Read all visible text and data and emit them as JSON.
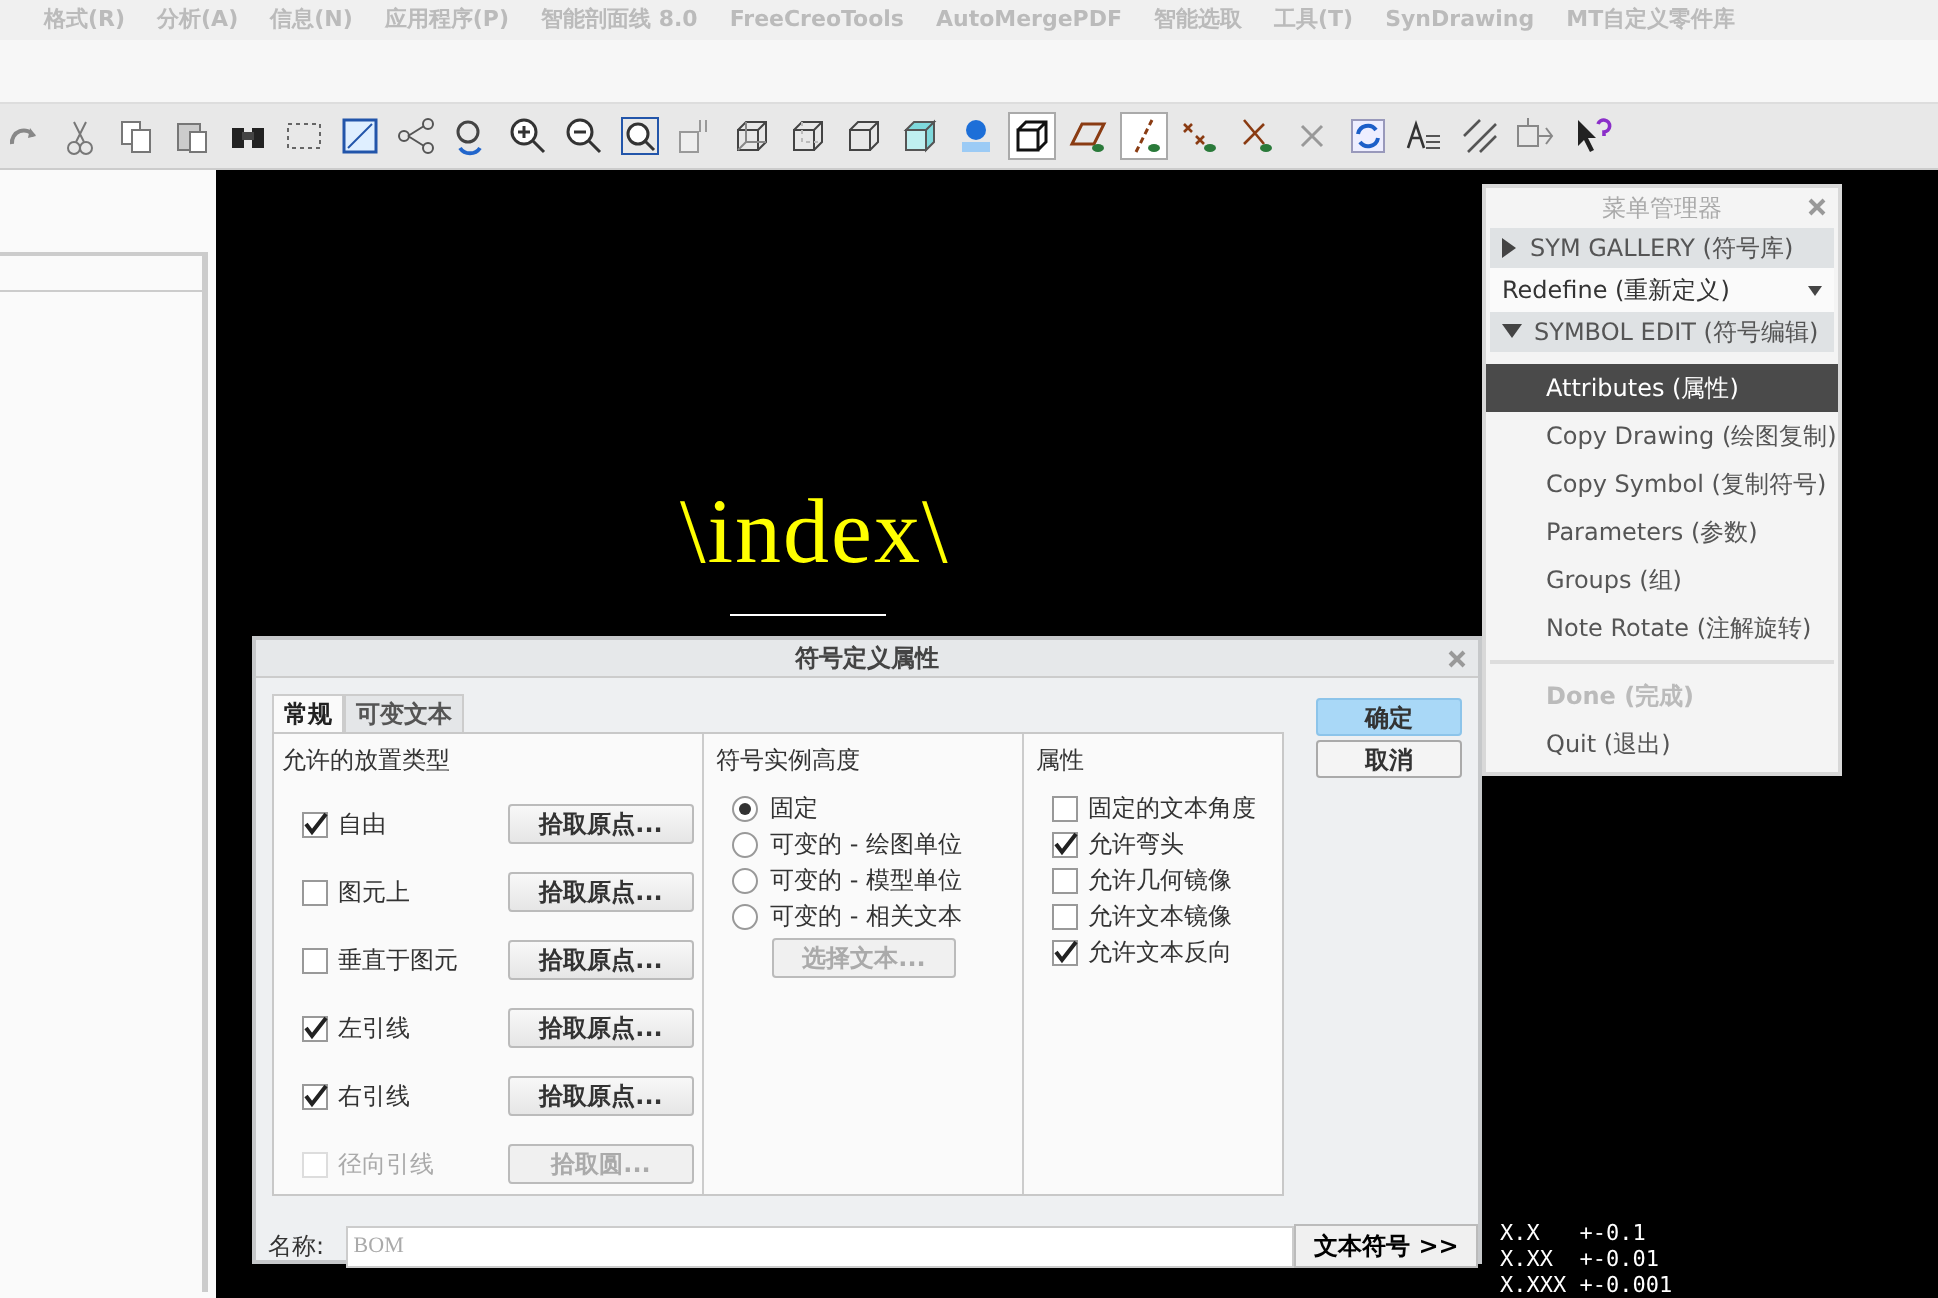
{
  "menu_bar": [
    "格式(R)",
    "分析(A)",
    "信息(N)",
    "应用程序(P)",
    "智能剖面线 8.0",
    "FreeCreoTools",
    "AutoMergePDF",
    "智能选取",
    "工具(T)",
    "SynDrawing",
    "MT自定义零件库"
  ],
  "toolbar": [
    {
      "kind": "redo",
      "selected": false
    },
    {
      "kind": "cut",
      "selected": false
    },
    {
      "kind": "copy",
      "selected": false
    },
    {
      "kind": "paste",
      "selected": false
    },
    {
      "kind": "find",
      "selected": false
    },
    {
      "kind": "selectbox",
      "selected": false
    },
    {
      "kind": "repaint",
      "selected": false
    },
    {
      "kind": "nodes",
      "selected": false
    },
    {
      "kind": "spin",
      "selected": false
    },
    {
      "kind": "zoomin",
      "selected": false
    },
    {
      "kind": "zoomout",
      "selected": false
    },
    {
      "kind": "zoomfit",
      "selected": false
    },
    {
      "kind": "textstyle",
      "selected": false
    },
    {
      "kind": "wire",
      "selected": false
    },
    {
      "kind": "hidden",
      "selected": false
    },
    {
      "kind": "nohidden",
      "selected": false
    },
    {
      "kind": "shaded",
      "selected": false
    },
    {
      "kind": "pin",
      "selected": false
    },
    {
      "kind": "cube",
      "selected": true
    },
    {
      "kind": "planes",
      "selected": false
    },
    {
      "kind": "axes",
      "selected": true
    },
    {
      "kind": "points",
      "selected": false
    },
    {
      "kind": "csys",
      "selected": false
    },
    {
      "kind": "cross",
      "selected": false
    },
    {
      "kind": "refresh",
      "selected": false
    },
    {
      "kind": "textlines",
      "selected": false
    },
    {
      "kind": "hatch",
      "selected": false
    },
    {
      "kind": "move",
      "selected": false
    },
    {
      "kind": "help",
      "selected": false
    }
  ],
  "canvas": {
    "note": "\\index\\",
    "tolerances": [
      "X.X   +-0.1",
      "X.XX  +-0.01",
      "X.XXX +-0.001"
    ]
  },
  "menu_manager": {
    "title": "菜单管理器",
    "sections": [
      {
        "kind": "header",
        "label": "SYM GALLERY (符号库)",
        "expanded": false
      },
      {
        "kind": "dropdown",
        "label": "Redefine (重新定义)"
      },
      {
        "kind": "header",
        "label": "SYMBOL EDIT (符号编辑)",
        "expanded": true
      }
    ],
    "items": [
      {
        "label": "Attributes (属性)",
        "selected": true,
        "disabled": false
      },
      {
        "label": "Copy Drawing (绘图复制)",
        "selected": false,
        "disabled": false
      },
      {
        "label": "Copy Symbol (复制符号)",
        "selected": false,
        "disabled": false
      },
      {
        "label": "Parameters (参数)",
        "selected": false,
        "disabled": false
      },
      {
        "label": "Groups (组)",
        "selected": false,
        "disabled": false
      },
      {
        "label": "Note Rotate (注解旋转)",
        "selected": false,
        "disabled": false
      }
    ],
    "footer_items": [
      {
        "label": "Done (完成)",
        "selected": false,
        "disabled": true
      },
      {
        "label": "Quit (退出)",
        "selected": false,
        "disabled": false
      }
    ]
  },
  "dialog": {
    "title": "符号定义属性",
    "tabs": [
      {
        "label": "常规",
        "selected": true
      },
      {
        "label": "可变文本",
        "selected": false
      }
    ],
    "placement": {
      "title": "允许的放置类型",
      "options": [
        {
          "label": "自由",
          "checked": true,
          "disabled": false,
          "button": "拾取原点..."
        },
        {
          "label": "图元上",
          "checked": false,
          "disabled": false,
          "button": "拾取原点..."
        },
        {
          "label": "垂直于图元",
          "checked": false,
          "disabled": false,
          "button": "拾取原点..."
        },
        {
          "label": "左引线",
          "checked": true,
          "disabled": false,
          "button": "拾取原点..."
        },
        {
          "label": "右引线",
          "checked": true,
          "disabled": false,
          "button": "拾取原点..."
        },
        {
          "label": "径向引线",
          "checked": false,
          "disabled": true,
          "button": "拾取圆..."
        }
      ]
    },
    "height": {
      "title": "符号实例高度",
      "options": [
        {
          "label": "固定",
          "selected": true
        },
        {
          "label": "可变的 - 绘图单位",
          "selected": false
        },
        {
          "label": "可变的 - 模型单位",
          "selected": false
        },
        {
          "label": "可变的 - 相关文本",
          "selected": false
        }
      ],
      "button": "选择文本...",
      "button_disabled": true
    },
    "properties": {
      "title": "属性",
      "options": [
        {
          "label": "固定的文本角度",
          "checked": false
        },
        {
          "label": "允许弯头",
          "checked": true
        },
        {
          "label": "允许几何镜像",
          "checked": false
        },
        {
          "label": "允许文本镜像",
          "checked": false
        },
        {
          "label": "允许文本反向",
          "checked": true
        }
      ]
    },
    "ok": "确定",
    "cancel": "取消",
    "name_label": "名称:",
    "name_value": "BOM",
    "text_symbol_button": "文本符号 >>"
  }
}
